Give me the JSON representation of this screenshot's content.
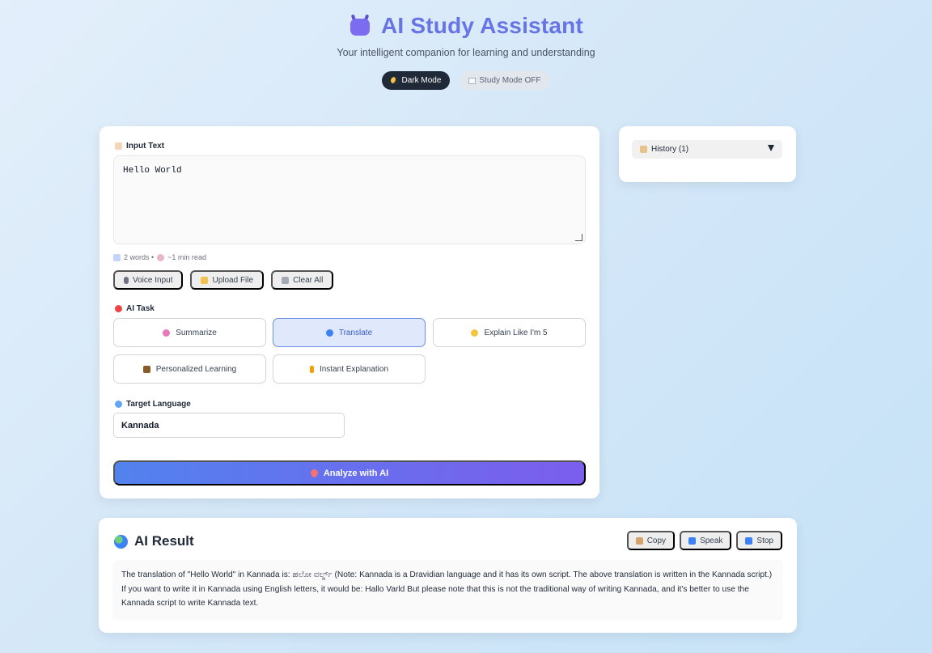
{
  "header": {
    "title": "AI Study Assistant",
    "subtitle": "Your intelligent companion for learning and understanding",
    "icon": "robot-icon"
  },
  "toggles": {
    "dark_mode_label": "Dark Mode",
    "study_mode_label": "Study Mode OFF"
  },
  "input": {
    "label": "Input Text",
    "value": "Hello World",
    "word_count": "2 words •",
    "read_time": "~1 min read",
    "buttons": {
      "voice": "Voice Input",
      "upload": "Upload File",
      "clear": "Clear All"
    }
  },
  "task": {
    "label": "AI Task",
    "options": [
      {
        "label": "Summarize",
        "icon": "brain-icon"
      },
      {
        "label": "Translate",
        "icon": "globe-icon",
        "active": true
      },
      {
        "label": "Explain Like I'm 5",
        "icon": "child-icon"
      },
      {
        "label": "Personalized Learning",
        "icon": "books-icon"
      },
      {
        "label": "Instant Explanation",
        "icon": "lightning-icon"
      }
    ]
  },
  "language": {
    "label": "Target Language",
    "value": "Kannada"
  },
  "analyze_label": "Analyze with AI",
  "history": {
    "label": "History (1)"
  },
  "result": {
    "title": "AI Result",
    "copy_label": "Copy",
    "speak_label": "Speak",
    "stop_label": "Stop",
    "text": "The translation of \"Hello World\" in Kannada is: ಹಲೋ ವರ್ಲ್ಡ್ (Note: Kannada is a Dravidian language and it has its own script. The above translation is written in the Kannada script.) If you want to write it in Kannada using English letters, it would be: Hallo Varld But please note that this is not the traditional way of writing Kannada, and it's better to use the Kannada script to write Kannada text."
  },
  "colors": {
    "accent": "#6674e6",
    "active_task_bg": "#e0e9fb",
    "analyze_gradient_start": "#5282ee",
    "analyze_gradient_end": "#7c5ded",
    "dark_pill": "#1f2937"
  }
}
